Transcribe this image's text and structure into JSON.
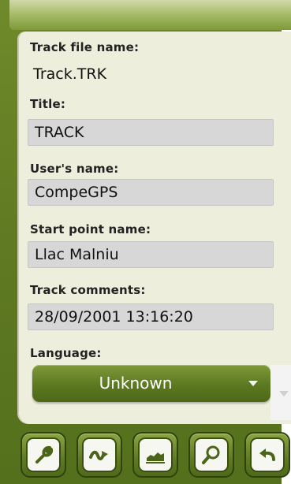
{
  "fields": {
    "track_file_name": {
      "label": "Track file name:",
      "value": "Track.TRK"
    },
    "title": {
      "label": "Title:",
      "value": "TRACK"
    },
    "users_name": {
      "label": "User's name:",
      "value": "CompeGPS"
    },
    "start_point_name": {
      "label": "Start point name:",
      "value": "Llac Malniu"
    },
    "track_comments": {
      "label": "Track comments:",
      "value": "28/09/2001 13:16:20"
    },
    "language": {
      "label": "Language:",
      "value": "Unknown"
    }
  },
  "toolbar": {
    "buttons": [
      {
        "icon": "wrench-icon"
      },
      {
        "icon": "track-route-icon"
      },
      {
        "icon": "elevation-profile-icon"
      },
      {
        "icon": "magnifier-icon"
      },
      {
        "icon": "undo-arrow-icon"
      }
    ]
  },
  "colors": {
    "frame_green": "#5f7a22",
    "panel_bg": "#eeeedd",
    "field_bg": "#d7d7d7"
  }
}
